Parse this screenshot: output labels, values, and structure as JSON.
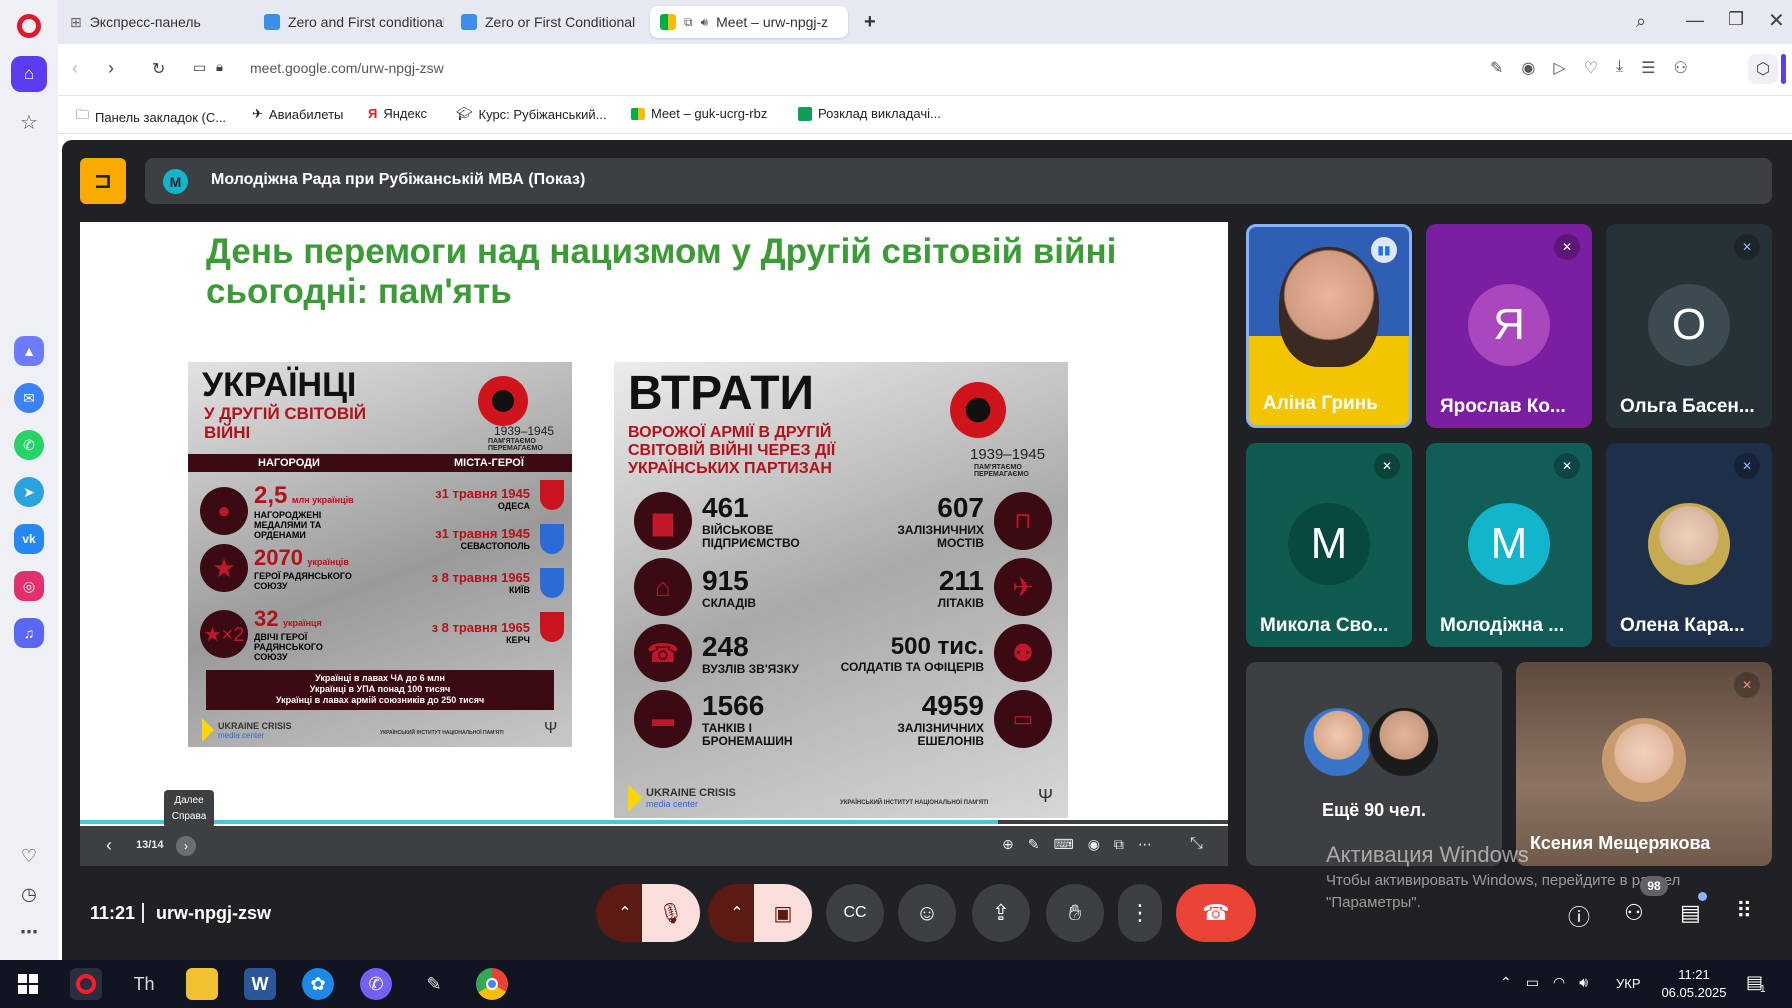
{
  "browser": {
    "tabs": [
      {
        "label": "Экспресс-панель"
      },
      {
        "label": "Zero and First conditional"
      },
      {
        "label": "Zero or First Conditional -"
      },
      {
        "label": "Meet – urw-npgj-z"
      }
    ],
    "new_tab_label": "+",
    "url": "meet.google.com/urw-npgj-zsw",
    "bookmarks": [
      {
        "label": "Панель закладок (С..."
      },
      {
        "label": "Авиабилеты"
      },
      {
        "label": "Яндекс"
      },
      {
        "label": "Курс: Рубіжанський..."
      },
      {
        "label": "Meet – guk-ucrg-rbz"
      },
      {
        "label": "Розклад викладачі..."
      }
    ]
  },
  "meet": {
    "presenter_badge": "M",
    "presenter_title": "Молодіжна Рада при Рубіжанській МВА (Показ)",
    "slide": {
      "title": "День перемоги над нацизмом у Другій світовій війні сьогодні: пам'ять",
      "counter": "13/14",
      "tooltip_line1": "Далее",
      "tooltip_line2": "Справа",
      "progress": 0.8,
      "left_card": {
        "heading": "УКРАЇНЦІ",
        "subheading": "У ДРУГІЙ СВІТОВІЙ ВІЙНІ",
        "years": "1939–1945",
        "motto": "ПАМ'ЯТАЄМО ПЕРЕМАГАЄМО",
        "col_awards": "НАГОРОДИ",
        "col_cities": "МІСТА-ГЕРОЇ",
        "awards": [
          {
            "num": "2,5",
            "unit": "млн українців",
            "text": "НАГОРОДЖЕНІ МЕДАЛЯМИ ТА ОРДЕНАМИ"
          },
          {
            "num": "2070",
            "unit": "українців",
            "text": "ГЕРОЇ РАДЯНСЬКОГО СОЮЗУ"
          },
          {
            "num": "32",
            "unit": "українця",
            "text": "ДВІЧІ ГЕРОЇ РАДЯНСЬКОГО СОЮЗУ"
          }
        ],
        "cities": [
          {
            "date": "з1 травня 1945",
            "city": "ОДЕСА"
          },
          {
            "date": "з1 травня 1945",
            "city": "СЕВАСТОПОЛЬ"
          },
          {
            "date": "з 8 травня 1965",
            "city": "КИЇВ"
          },
          {
            "date": "з 8 травня 1965",
            "city": "КЕРЧ"
          }
        ],
        "footer_lines": [
          "Українці в лавах ЧА до 6 млн",
          "Українці в УПА понад 100 тисяч",
          "Українці в лавах армій союзників до 250 тисяч"
        ],
        "logo": "UKRAINE CRISIS",
        "logo_sub": "media center",
        "institute": "УКРАЇНСЬКИЙ ІНСТИТУТ НАЦІОНАЛЬНОЇ ПАМ'ЯТІ"
      },
      "right_card": {
        "heading": "ВТРАТИ",
        "subheading": "ВОРОЖОЇ АРМІЇ В ДРУГІЙ СВІТОВІЙ ВІЙНІ ЧЕРЕЗ ДІЇ УКРАЇНСЬКИХ ПАРТИЗАН",
        "years": "1939–1945",
        "motto": "ПАМ'ЯТАЄМО ПЕРЕМАГАЄМО",
        "left_stats": [
          {
            "num": "461",
            "label": "ВІЙСЬКОВЕ ПІДПРИЄМСТВО"
          },
          {
            "num": "915",
            "label": "СКЛАДІВ"
          },
          {
            "num": "248",
            "label": "ВУЗЛІВ ЗВ'ЯЗКУ"
          },
          {
            "num": "1566",
            "label": "ТАНКІВ І БРОНЕМАШИН"
          }
        ],
        "right_stats": [
          {
            "num": "607",
            "label": "ЗАЛІЗНИЧНИХ МОСТІВ"
          },
          {
            "num": "211",
            "label": "ЛІТАКІВ"
          },
          {
            "num": "500 тис.",
            "label": "СОЛДАТІВ ТА ОФІЦЕРІВ"
          },
          {
            "num": "4959",
            "label": "ЗАЛІЗНИЧНИХ ЕШЕЛОНІВ"
          }
        ],
        "logo": "UKRAINE CRISIS",
        "logo_sub": "media center",
        "institute": "УКРАЇНСЬКИЙ ІНСТИТУТ НАЦІОНАЛЬНОЇ ПАМ'ЯТІ"
      }
    },
    "participants": [
      {
        "name": "Аліна Гринь"
      },
      {
        "name": "Ярослав Ко...",
        "initial": "Я"
      },
      {
        "name": "Ольга Басен...",
        "initial": "О"
      },
      {
        "name": "Микола Сво...",
        "initial": "М"
      },
      {
        "name": "Молодіжна ...",
        "initial": "М"
      },
      {
        "name": "Олена Кара..."
      }
    ],
    "more_participants": "Ещё 90 чел.",
    "large_participant": "Ксения Мещерякова",
    "time": "11:21",
    "meeting_code": "urw-npgj-zsw",
    "people_count": "98",
    "windows_watermark_title": "Активация Windows",
    "windows_watermark_text": "Чтобы активировать Windows, перейдите в раздел \"Параметры\"."
  },
  "taskbar": {
    "language": "УКР",
    "clock_time": "11:21",
    "clock_date": "06.05.2025",
    "notif_count": "1"
  }
}
